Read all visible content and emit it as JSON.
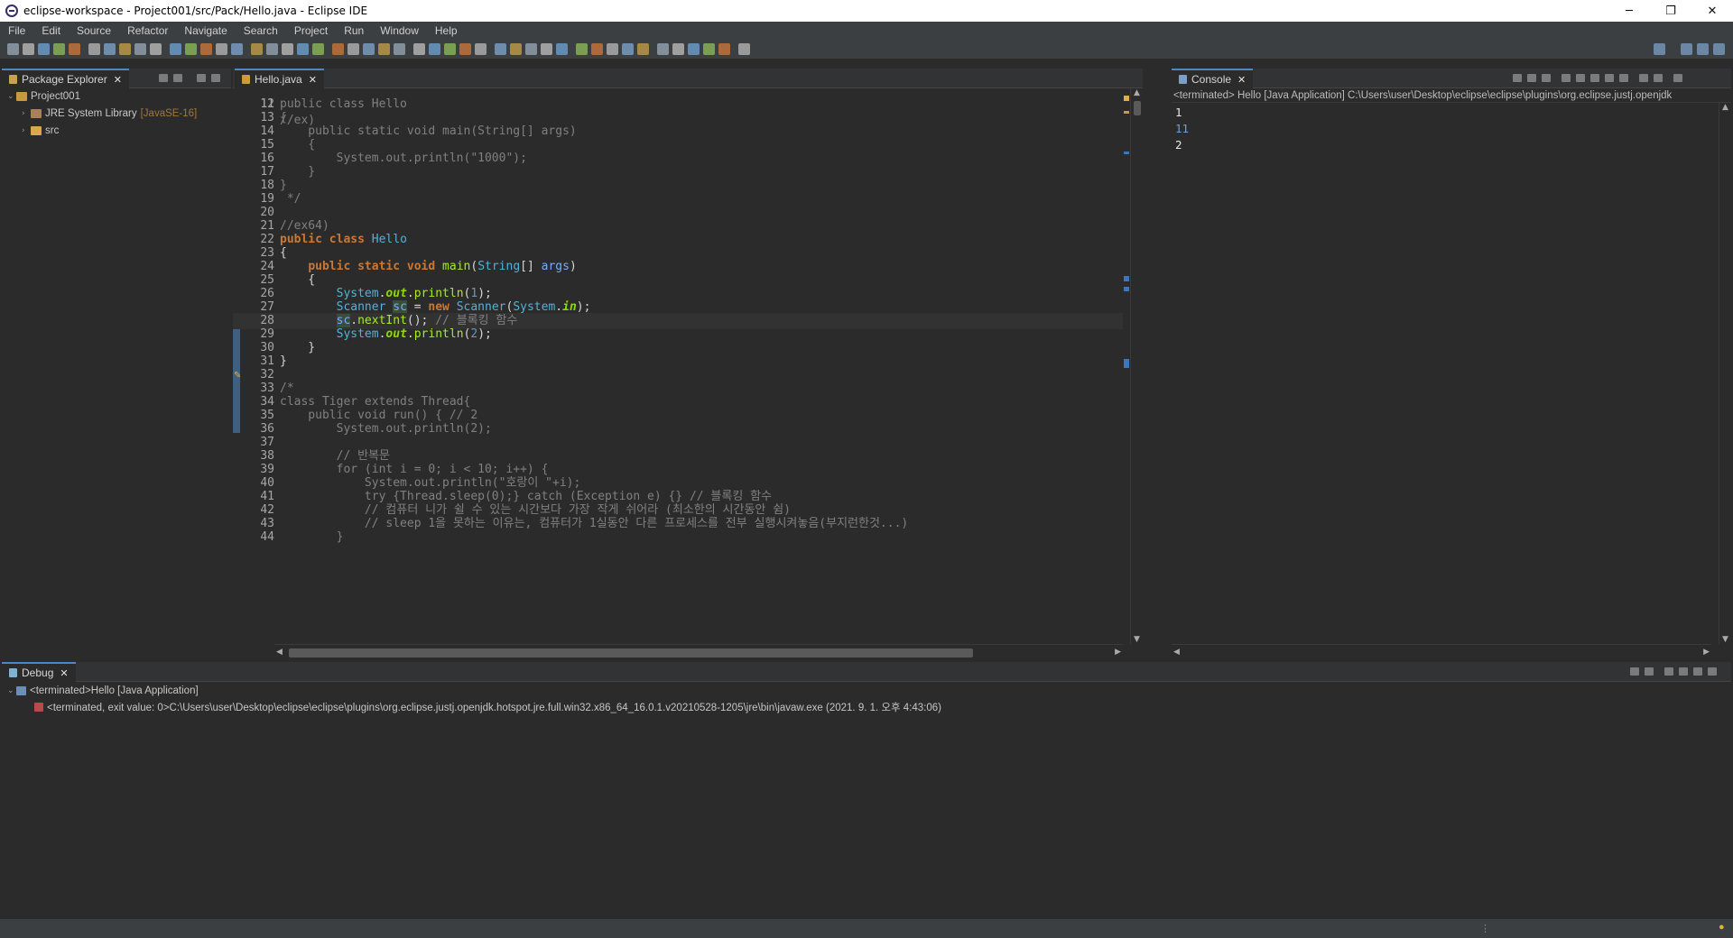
{
  "window": {
    "title": "eclipse-workspace - Project001/src/Pack/Hello.java - Eclipse IDE",
    "minimize": "─",
    "restore": "❐",
    "close": "✕"
  },
  "menu": [
    "File",
    "Edit",
    "Source",
    "Refactor",
    "Navigate",
    "Search",
    "Project",
    "Run",
    "Window",
    "Help"
  ],
  "package_explorer": {
    "tab_label": "Package Explorer",
    "tree": [
      {
        "label": "Project001",
        "decoration": "",
        "expanded": true
      },
      {
        "label": "JRE System Library",
        "decoration": "[JavaSE-16]",
        "expanded": false
      },
      {
        "label": "src",
        "decoration": "",
        "expanded": false
      }
    ]
  },
  "editor": {
    "tab_label": "Hello.java",
    "partial_top_line": {
      "number": "11",
      "text": "//ex)"
    },
    "lines": [
      {
        "n": "12",
        "html": "public class Hello"
      },
      {
        "n": "13",
        "html": "{"
      },
      {
        "n": "14",
        "html": "    public static void main(String[] args)"
      },
      {
        "n": "15",
        "html": "    {"
      },
      {
        "n": "16",
        "html": "        System.out.println(\"1000\");"
      },
      {
        "n": "17",
        "html": "    }"
      },
      {
        "n": "18",
        "html": "}"
      },
      {
        "n": "19",
        "html": " */"
      },
      {
        "n": "20",
        "html": ""
      },
      {
        "n": "21",
        "html": "//ex64)"
      },
      {
        "n": "22",
        "html": "public class Hello"
      },
      {
        "n": "23",
        "html": "{"
      },
      {
        "n": "24",
        "html": "    public static void main(String[] args)"
      },
      {
        "n": "25",
        "html": "    {"
      },
      {
        "n": "26",
        "html": "        System.out.println(1);"
      },
      {
        "n": "27",
        "html": "        Scanner sc = new Scanner(System.in);"
      },
      {
        "n": "28",
        "html": "        sc.nextInt(); // 블록킹 함수"
      },
      {
        "n": "29",
        "html": "        System.out.println(2);"
      },
      {
        "n": "30",
        "html": "    }"
      },
      {
        "n": "31",
        "html": "}"
      },
      {
        "n": "32",
        "html": ""
      },
      {
        "n": "33",
        "html": "/*"
      },
      {
        "n": "34",
        "html": "class Tiger extends Thread{"
      },
      {
        "n": "35",
        "html": "    public void run() { // 2"
      },
      {
        "n": "36",
        "html": "        System.out.println(2);"
      },
      {
        "n": "37",
        "html": ""
      },
      {
        "n": "38",
        "html": "        // 반복문"
      },
      {
        "n": "39",
        "html": "        for (int i = 0; i < 10; i++) {"
      },
      {
        "n": "40",
        "html": "            System.out.println(\"호랑이 \"+i);"
      },
      {
        "n": "41",
        "html": "            try {Thread.sleep(0);} catch (Exception e) {} // 블록킹 함수"
      },
      {
        "n": "42",
        "html": "            // 컴퓨터 니가 쉴 수 있는 시간보다 가장 작게 쉬어라 (최소한의 시간동안 쉼)"
      },
      {
        "n": "43",
        "html": "            // sleep 1을 못하는 이유는, 컴퓨터가 1실동안 다른 프로세스를 전부 실행시켜놓음(부지런한것...)"
      },
      {
        "n": "44",
        "html": "        }"
      }
    ]
  },
  "console": {
    "tab_label": "Console",
    "header": "<terminated> Hello [Java Application] C:\\Users\\user\\Desktop\\eclipse\\eclipse\\plugins\\org.eclipse.justj.openjdk",
    "output": [
      "1",
      "11",
      "2"
    ]
  },
  "debug": {
    "tab_label": "Debug",
    "rows": [
      "<terminated>Hello [Java Application]",
      "<terminated, exit value: 0>C:\\Users\\user\\Desktop\\eclipse\\eclipse\\plugins\\org.eclipse.justj.openjdk.hotspot.jre.full.win32.x86_64_16.0.1.v20210528-1205\\jre\\bin\\javaw.exe  (2021. 9. 1. 오후 4:43:06)"
    ]
  }
}
